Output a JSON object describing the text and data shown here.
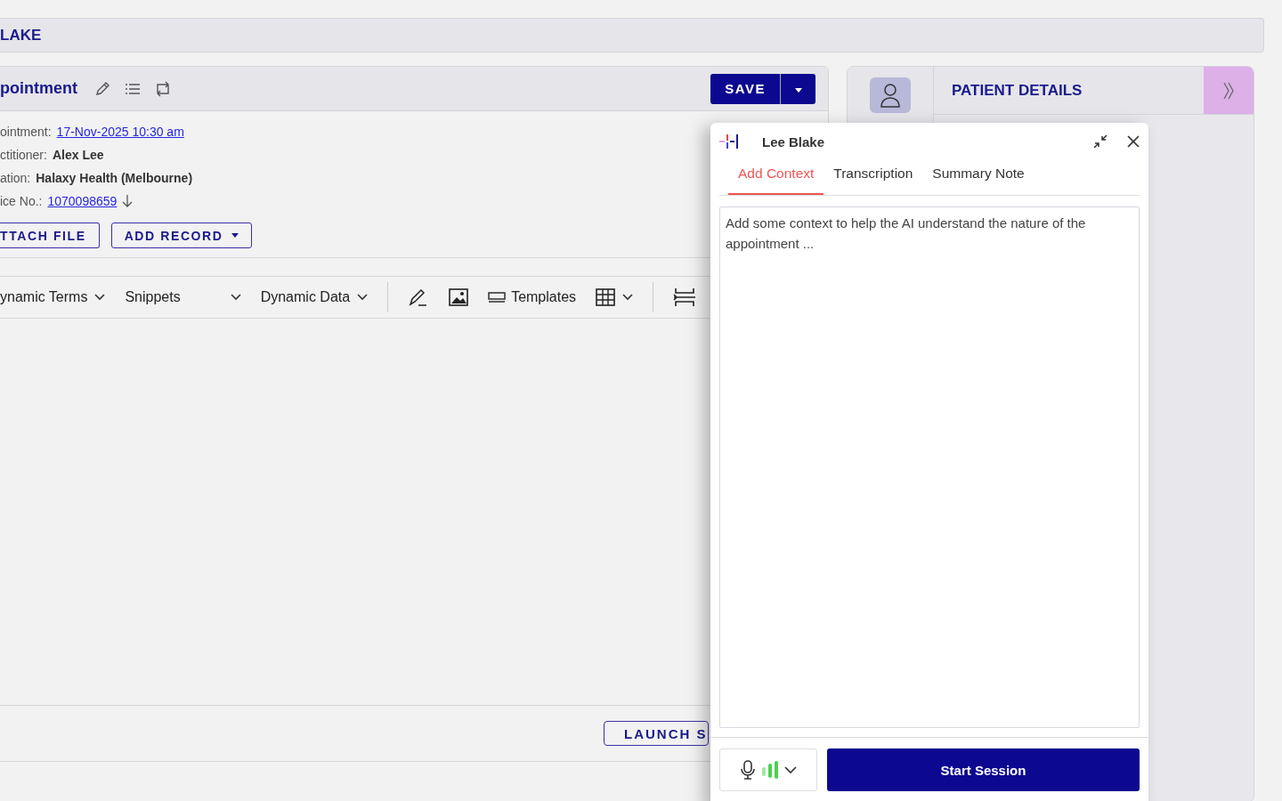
{
  "header": {
    "title": "LAKE"
  },
  "appointment": {
    "title": "pointment",
    "fields": [
      {
        "label": "ointment:",
        "value": "17-Nov-2025 10:30 am",
        "kind": "link"
      },
      {
        "label": "ctitioner:",
        "value": "Alex Lee",
        "kind": "text"
      },
      {
        "label": "ation:",
        "value": "Halaxy Health (Melbourne)",
        "kind": "text"
      },
      {
        "label": "ice No.:",
        "value": "1070098659",
        "kind": "download"
      }
    ],
    "buttons": [
      "TTACH FILE",
      "ADD RECORD"
    ],
    "save": "SAVE",
    "toolbar": [
      {
        "label": "ynamic Terms",
        "kind": "dropdown"
      },
      {
        "label": "Snippets",
        "kind": "dropdown"
      },
      {
        "label": "Dynamic Data",
        "kind": "dropdown"
      },
      {
        "label": "Templates",
        "kind": "templates"
      }
    ],
    "launch": "LAUNCH S"
  },
  "patient_panel": {
    "title": "PATIENT DETAILS"
  },
  "scribe": {
    "name": "Lee Blake",
    "tabs": [
      {
        "label": "Add Context",
        "selected": true
      },
      {
        "label": "Transcription",
        "selected": false
      },
      {
        "label": "Summary Note",
        "selected": false
      }
    ],
    "context": {
      "placeholder": "Add some context to help the AI understand the nature of the appointment ..."
    },
    "start": "Start Session"
  }
}
